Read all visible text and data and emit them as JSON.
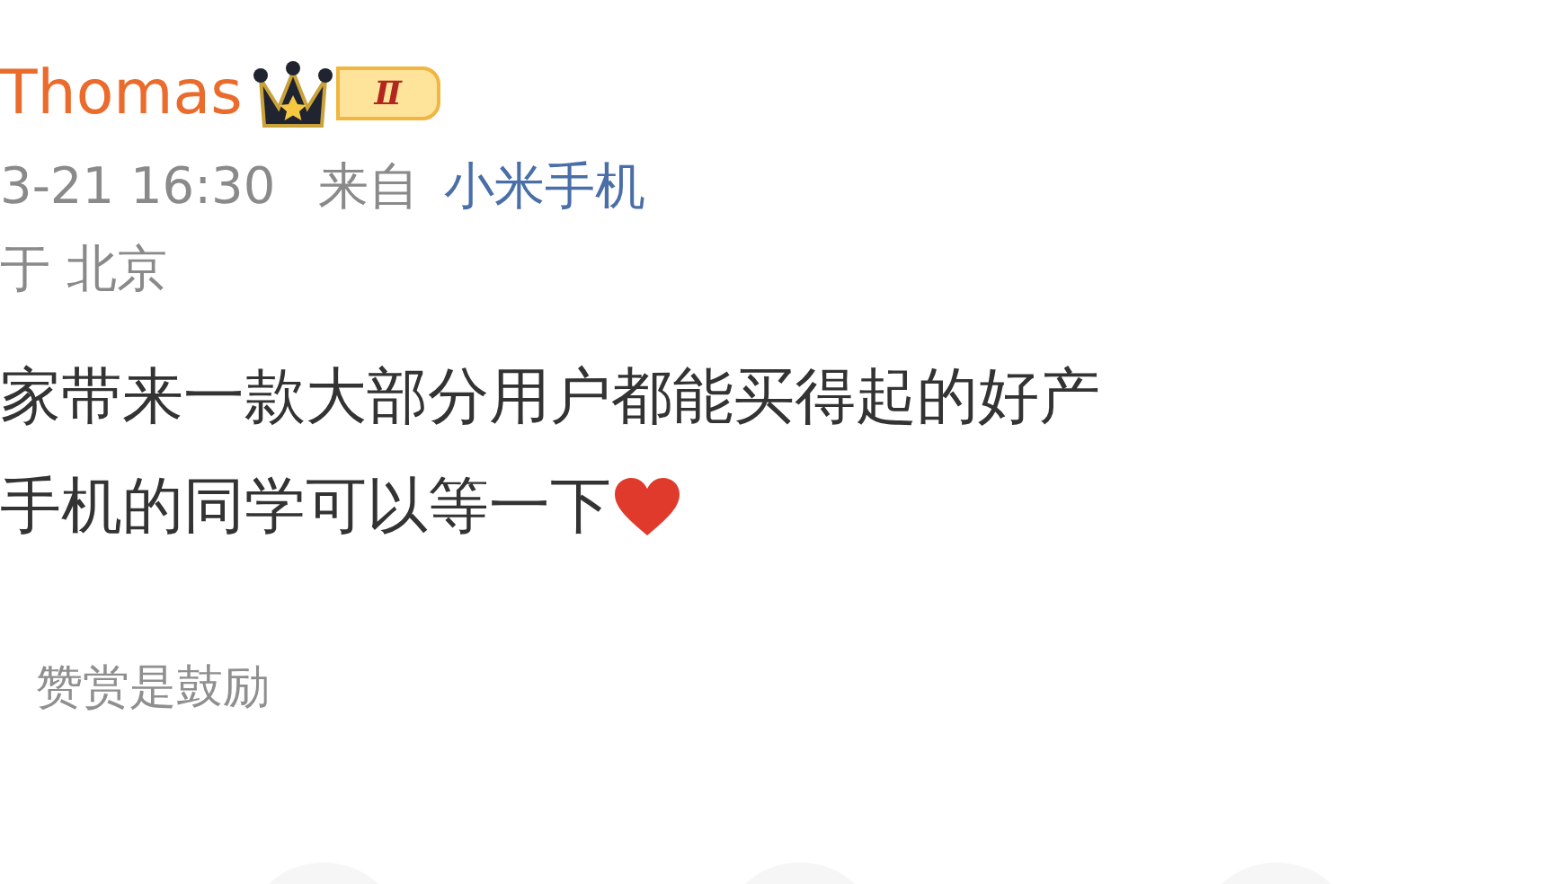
{
  "post": {
    "author": "Thomas",
    "badge": "Ⅱ",
    "time": "3-21 16:30",
    "source_prefix": "来自",
    "source": "小米手机",
    "location": "于 北京",
    "lines": [
      "家带来一款大部分用户都能买得起的好产",
      "手机的同学可以等一下"
    ],
    "reward": "赞赏是鼓励"
  }
}
